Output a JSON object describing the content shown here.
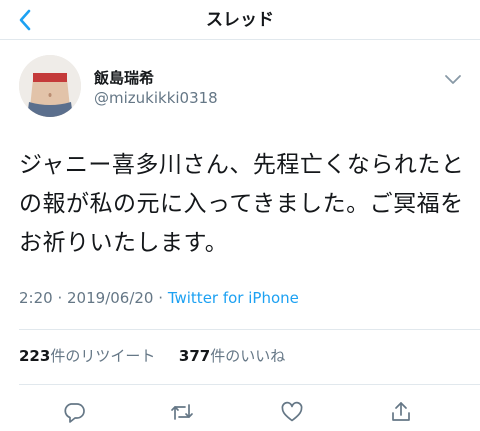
{
  "header": {
    "title": "スレッド",
    "back_icon": "chevron-left-icon"
  },
  "colors": {
    "accent": "#1da1f2",
    "secondary_text": "#657786",
    "divider": "#e1e8ed"
  },
  "tweet": {
    "display_name": "飯島瑞希",
    "handle": "@mizukikki0318",
    "text": "ジャニー喜多川さん、先程亡くなられたとの報が私の元に入ってきました。ご冥福をお祈りいたします。",
    "time": "2:20",
    "date": "2019/06/20",
    "source": "Twitter for iPhone",
    "retweets": "223",
    "retweets_label": "件のリツイート",
    "likes": "377",
    "likes_label": "件のいいね"
  },
  "actions": [
    "reply-icon",
    "retweet-icon",
    "like-icon",
    "share-icon"
  ]
}
